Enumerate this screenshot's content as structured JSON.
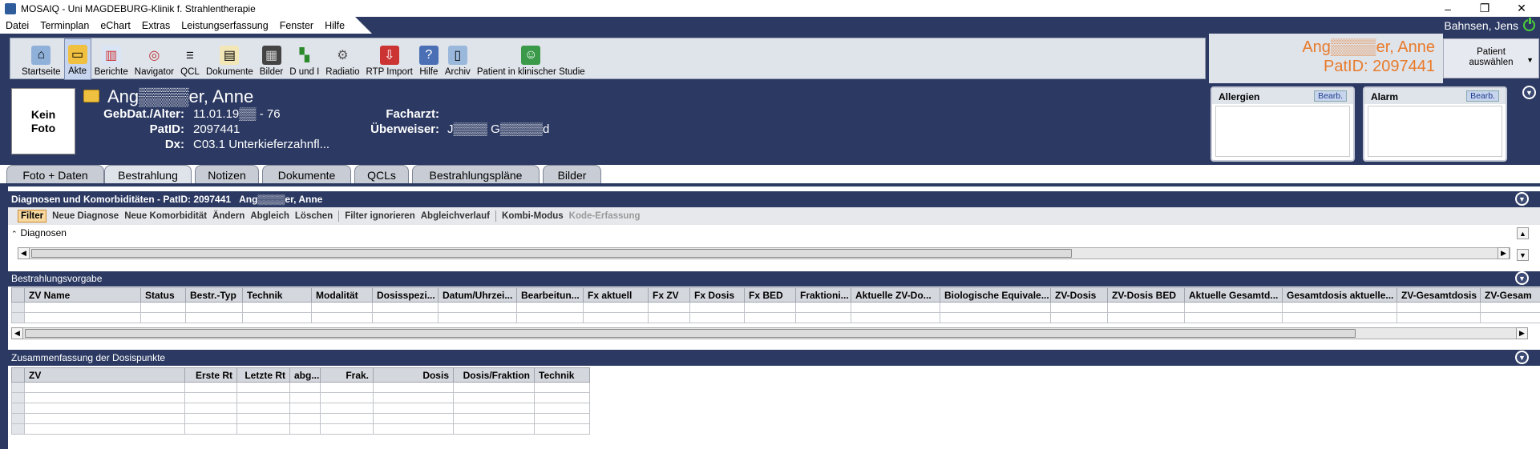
{
  "window": {
    "title": "MOSAIQ - Uni MAGDEBURG-Klinik f. Strahlentherapie",
    "controls": [
      "–",
      "❐",
      "✕"
    ]
  },
  "menu": {
    "items": [
      "Datei",
      "Terminplan",
      "eChart",
      "Extras",
      "Leistungserfassung",
      "Fenster",
      "Hilfe"
    ],
    "user": "Bahnsen, Jens"
  },
  "toolbar": {
    "buttons": [
      {
        "label": "Startseite",
        "icon": "home-icon",
        "active": false
      },
      {
        "label": "Akte",
        "icon": "folder-icon",
        "active": true
      },
      {
        "label": "Berichte",
        "icon": "reports-icon",
        "active": false
      },
      {
        "label": "Navigator",
        "icon": "navigator-icon",
        "active": false
      },
      {
        "label": "QCL",
        "icon": "checklist-icon",
        "active": false
      },
      {
        "label": "Dokumente",
        "icon": "documents-icon",
        "active": false
      },
      {
        "label": "Bilder",
        "icon": "images-icon",
        "active": false
      },
      {
        "label": "D und I",
        "icon": "diagnosis-icon",
        "active": false
      },
      {
        "label": "Radiatio",
        "icon": "radiation-icon",
        "active": false
      },
      {
        "label": "RTP Import",
        "icon": "import-icon",
        "active": false
      },
      {
        "label": "Hilfe",
        "icon": "help-icon",
        "active": false
      },
      {
        "label": "Archiv",
        "icon": "archive-icon",
        "active": false
      },
      {
        "label": "Patient in klinischer Studie",
        "icon": "study-icon",
        "active": false
      }
    ]
  },
  "patient_banner": {
    "name": "Ang▒▒▒▒er, Anne",
    "patid": "PatID: 2097441",
    "select_label": "Patient auswählen"
  },
  "patient": {
    "photo": "Kein Foto",
    "name": "Ang▒▒▒▒er, Anne",
    "labels": {
      "dob": "GebDat./Alter:",
      "patid": "PatID:",
      "dx": "Dx:",
      "facharzt": "Facharzt:",
      "ueberweiser": "Überweiser:"
    },
    "dob": "11.01.19▒▒ - 76",
    "patid": "2097441",
    "dx": "C03.1 Unterkieferzahnfl...",
    "facharzt": "",
    "ueberweiser": "J▒▒▒▒ G▒▒▒▒▒d"
  },
  "allergien": {
    "title": "Allergien",
    "edit": "Bearb."
  },
  "alarm": {
    "title": "Alarm",
    "edit": "Bearb."
  },
  "tabs": [
    "Foto + Daten",
    "Bestrahlung",
    "Notizen",
    "Dokumente",
    "QCLs",
    "Bestrahlungspläne",
    "Bilder"
  ],
  "active_tab": "Bestrahlung",
  "diagnosen_panel": {
    "title": "Diagnosen und Komorbiditäten - PatID: 2097441",
    "patient_name": "Ang▒▒▒▒er, Anne",
    "actions": [
      "Filter",
      "Neue Diagnose",
      "Neue Komorbidität",
      "Ändern",
      "Abgleich",
      "Löschen",
      "Filter ignorieren",
      "Abgleichverlauf",
      "Kombi-Modus",
      "Kode-Erfassung"
    ],
    "section": "Diagnosen"
  },
  "vorgabe_panel": {
    "title": "Bestrahlungsvorgabe",
    "columns": [
      "ZV Name",
      "Status",
      "Bestr.-Typ",
      "Technik",
      "Modalität",
      "Dosisspezi...",
      "Datum/Uhrzei...",
      "Bearbeitun...",
      "Fx aktuell",
      "Fx ZV",
      "Fx Dosis",
      "Fx BED",
      "Fraktioni...",
      "Aktuelle ZV-Do...",
      "Biologische Equivale...",
      "ZV-Dosis",
      "ZV-Dosis BED",
      "Aktuelle Gesamtd...",
      "Gesamtdosis aktuelle...",
      "ZV-Gesamtdosis",
      "ZV-Gesam"
    ]
  },
  "dosis_panel": {
    "title": "Zusammenfassung der Dosispunkte",
    "columns": [
      "ZV",
      "Erste Rt",
      "Letzte Rt",
      "abg...",
      "Frak.",
      "Dosis",
      "Dosis/Fraktion",
      "Technik"
    ]
  },
  "colors": {
    "navy": "#2c3a63",
    "orange": "#e87b2a"
  }
}
